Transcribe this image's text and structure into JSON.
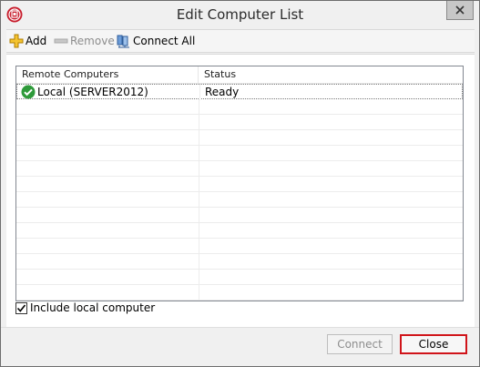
{
  "window": {
    "title": "Edit Computer List"
  },
  "toolbar": {
    "add_label": "Add",
    "remove_label": "Remove",
    "connect_all_label": "Connect All"
  },
  "grid": {
    "columns": [
      "Remote Computers",
      "Status"
    ],
    "rows": [
      {
        "computer": "Local (SERVER2012)",
        "status": "Ready"
      }
    ]
  },
  "options": {
    "include_local_label": "Include local computer",
    "include_local_checked": true
  },
  "buttons": {
    "connect_label": "Connect",
    "close_label": "Close"
  },
  "colors": {
    "close_highlight": "#d0141a",
    "disabled_text": "#8d8d8d",
    "ok_green": "#2e9a3a"
  },
  "icons": {
    "app": "app-logo-icon",
    "add": "add-plus-icon",
    "remove": "remove-minus-icon",
    "connect_all": "connect-all-icon",
    "status_ok": "checkmark-ok-icon"
  }
}
